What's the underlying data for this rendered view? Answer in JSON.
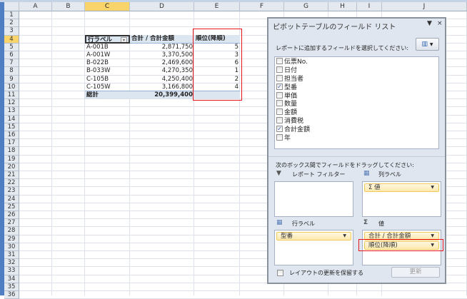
{
  "columns": [
    "A",
    "B",
    "C",
    "D",
    "E",
    "F",
    "G",
    "H",
    "I",
    "J"
  ],
  "selected_column": "C",
  "row_numbers": [
    "1",
    "2",
    "3",
    "4",
    "5",
    "6",
    "7",
    "8",
    "9",
    "10",
    "11",
    "12",
    "13",
    "14",
    "15",
    "16",
    "17",
    "18",
    "19",
    "20",
    "21",
    "22",
    "23",
    "24",
    "25",
    "26",
    "27",
    "28",
    "29",
    "30",
    "31",
    "32",
    "33",
    "34",
    "35",
    "36"
  ],
  "selected_row": "4",
  "pivot": {
    "headers": {
      "row_label": "行ラベル",
      "sum": "合計 / 合計金額",
      "rank": "順位(降順)"
    },
    "rows": [
      {
        "label": "A-001B",
        "sum": "2,871,750",
        "rank": "5"
      },
      {
        "label": "A-001W",
        "sum": "3,370,500",
        "rank": "3"
      },
      {
        "label": "B-022B",
        "sum": "2,469,600",
        "rank": "6"
      },
      {
        "label": "B-033W",
        "sum": "4,270,350",
        "rank": "1"
      },
      {
        "label": "C-105B",
        "sum": "4,250,400",
        "rank": "2"
      },
      {
        "label": "C-105W",
        "sum": "3,166,800",
        "rank": "4"
      }
    ],
    "total": {
      "label": "総計",
      "sum": "20,399,400",
      "rank": ""
    }
  },
  "field_list": {
    "title": "ピボットテーブルのフィールド リスト",
    "dropdown_glyph": "▼",
    "close_glyph": "×",
    "choose_prompt": "レポートに追加するフィールドを選択してください:",
    "fields": [
      {
        "name": "伝票No.",
        "checked": false
      },
      {
        "name": "日付",
        "checked": false
      },
      {
        "name": "担当者",
        "checked": false
      },
      {
        "name": "型番",
        "checked": true
      },
      {
        "name": "単価",
        "checked": false
      },
      {
        "name": "数量",
        "checked": false
      },
      {
        "name": "金額",
        "checked": false
      },
      {
        "name": "消費税",
        "checked": false
      },
      {
        "name": "合計金額",
        "checked": true
      },
      {
        "name": "年",
        "checked": false
      }
    ],
    "drag_prompt": "次のボックス間でフィールドをドラッグしてください:",
    "areas": {
      "report_filter": "レポート フィルター",
      "column_labels": "列ラベル",
      "row_labels": "行ラベル",
      "values": "値"
    },
    "column_items": [
      "Σ 値"
    ],
    "row_items": [
      "型番"
    ],
    "value_items": [
      "合計 / 合計金額",
      "順位(降順)"
    ],
    "defer_label": "レイアウトの更新を保留する",
    "update_button": "更新"
  },
  "colors": {
    "highlight_red": "#e8141a",
    "selected_header": "#f8d46a"
  }
}
